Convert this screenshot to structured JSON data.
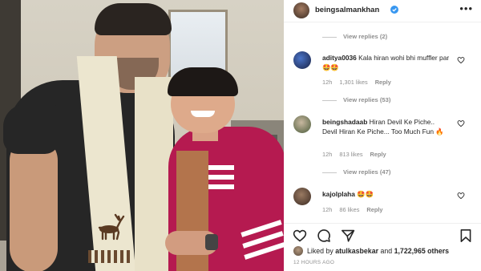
{
  "header": {
    "username": "beingsalmankhan",
    "more_icon": "more-horizontal-icon"
  },
  "replies_top": {
    "label": "View replies (2)"
  },
  "comments": [
    {
      "username": "aditya0036",
      "text": "Kala hiran wohi bhi muffler par 🤩🤩",
      "time": "12h",
      "likes": "1,301 likes",
      "reply": "Reply",
      "view_replies": "View replies (53)"
    },
    {
      "username": "beingshadaab",
      "text": "Hiran Devil Ke Piche.. Devil Hiran Ke Piche... Too Much Fun 🔥",
      "time": "12h",
      "likes": "813 likes",
      "reply": "Reply",
      "view_replies": "View replies (47)"
    },
    {
      "username": "kajolplaha",
      "text": "🤩🤩",
      "time": "12h",
      "likes": "86 likes",
      "reply": "Reply"
    }
  ],
  "likes_bar": {
    "prefix": "Liked by ",
    "user": "atulkasbekar",
    "middle": " and ",
    "count": "1,722,965 others"
  },
  "timestamp": "12 HOURS AGO",
  "colors": {
    "verified": "#3897f0",
    "jacket": "#b51a50",
    "text": "#262626",
    "muted": "#8e8e8e"
  }
}
